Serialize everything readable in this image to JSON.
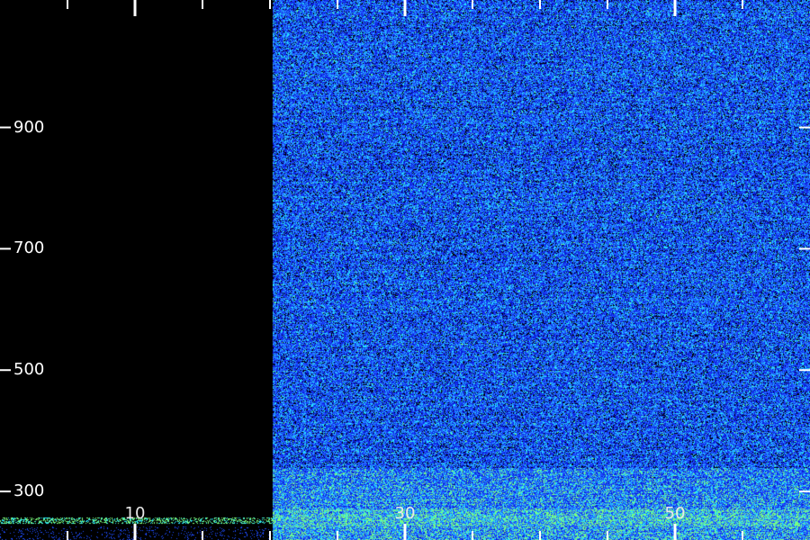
{
  "chart_data": {
    "type": "heatmap",
    "title": "",
    "xlabel": "",
    "ylabel": "",
    "xlim": [
      0,
      60
    ],
    "ylim": [
      220,
      1110
    ],
    "x_major_ticks": [
      10,
      30,
      50
    ],
    "x_minor_ticks": [
      5,
      15,
      20,
      25,
      35,
      40,
      45,
      55
    ],
    "y_major_ticks": [
      300,
      500,
      700,
      900
    ],
    "data_start_x": 20.2,
    "colormap": [
      "#000000",
      "#0a1bd8",
      "#1e4cff",
      "#2aa0ff",
      "#25e6ff",
      "#7cff7c"
    ],
    "description_values": {
      "empty_region_x": [
        0,
        20.2
      ],
      "dense_band_y": [
        220,
        340
      ]
    }
  }
}
